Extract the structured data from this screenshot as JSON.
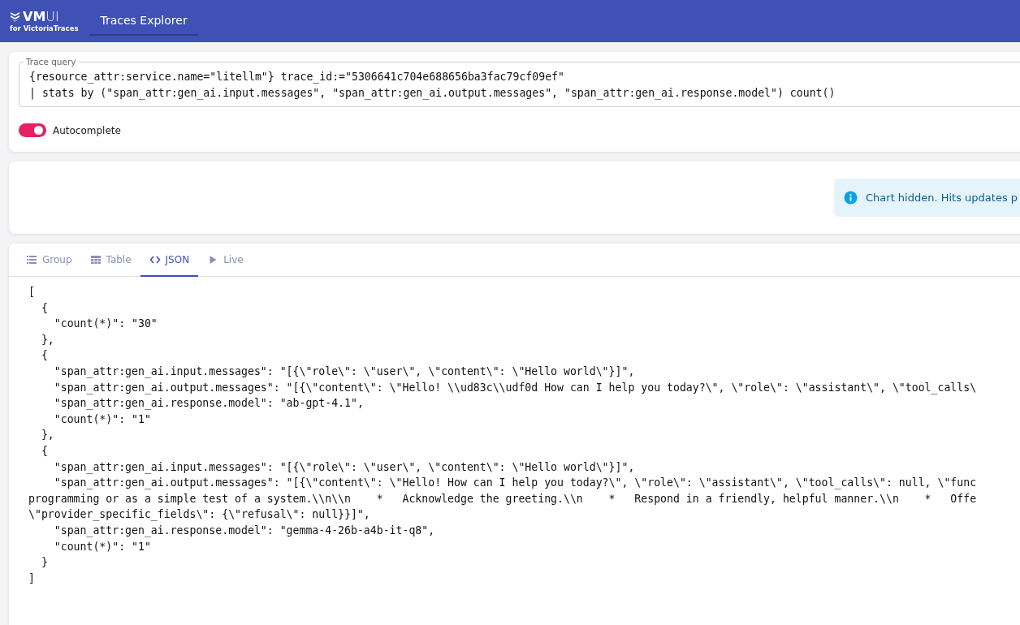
{
  "header": {
    "logo": {
      "title": "**VM**UI",
      "subtitle": "for VictoriaTraces"
    },
    "tabs": [
      {
        "label": "Traces Explorer",
        "selected": true
      }
    ]
  },
  "query": {
    "label": "Trace query",
    "lines": [
      "{resource_attr:service.name=\"litellm\"} trace_id:=\"5306641c704e688656ba3fac79cf09ef\"",
      "| stats by (\"span_attr:gen_ai.input.messages\", \"span_attr:gen_ai.output.messages\", \"span_attr:gen_ai.response.model\") count()"
    ]
  },
  "autocomplete": {
    "label": "Autocomplete",
    "on": true
  },
  "chart_notice": {
    "text": "Chart hidden. Hits updates p"
  },
  "view_tabs": [
    {
      "label": "Group",
      "kind": "group",
      "selected": false
    },
    {
      "label": "Table",
      "kind": "table",
      "selected": false
    },
    {
      "label": "JSON",
      "kind": "json",
      "selected": true
    },
    {
      "label": "Live",
      "kind": "live",
      "selected": false
    }
  ],
  "json_lines": [
    "[",
    "  {",
    "    \"count(*)\": \"30\"",
    "  },",
    "  {",
    "    \"span_attr:gen_ai.input.messages\": \"[{\\\"role\\\": \\\"user\\\", \\\"content\\\": \\\"Hello world\\\"}]\",",
    "    \"span_attr:gen_ai.output.messages\": \"[{\\\"content\\\": \\\"Hello! \\\\ud83c\\\\udf0d How can I help you today?\\\", \\\"role\\\": \\\"assistant\\\", \\\"tool_calls\\",
    "    \"span_attr:gen_ai.response.model\": \"ab-gpt-4.1\",",
    "    \"count(*)\": \"1\"",
    "  },",
    "  {",
    "    \"span_attr:gen_ai.input.messages\": \"[{\\\"role\\\": \\\"user\\\", \\\"content\\\": \\\"Hello world\\\"}]\",",
    "    \"span_attr:gen_ai.output.messages\": \"[{\\\"content\\\": \\\"Hello! How can I help you today?\\\", \\\"role\\\": \\\"assistant\\\", \\\"tool_calls\\\": null, \\\"func",
    "programming or as a simple test of a system.\\\\n\\\\n    *   Acknowledge the greeting.\\\\n    *   Respond in a friendly, helpful manner.\\\\n    *   Offe",
    "\\\"provider_specific_fields\\\": {\\\"refusal\\\": null}}]\",",
    "    \"span_attr:gen_ai.response.model\": \"gemma-4-26b-a4b-it-q8\",",
    "    \"count(*)\": \"1\"",
    "  }",
    "]"
  ]
}
